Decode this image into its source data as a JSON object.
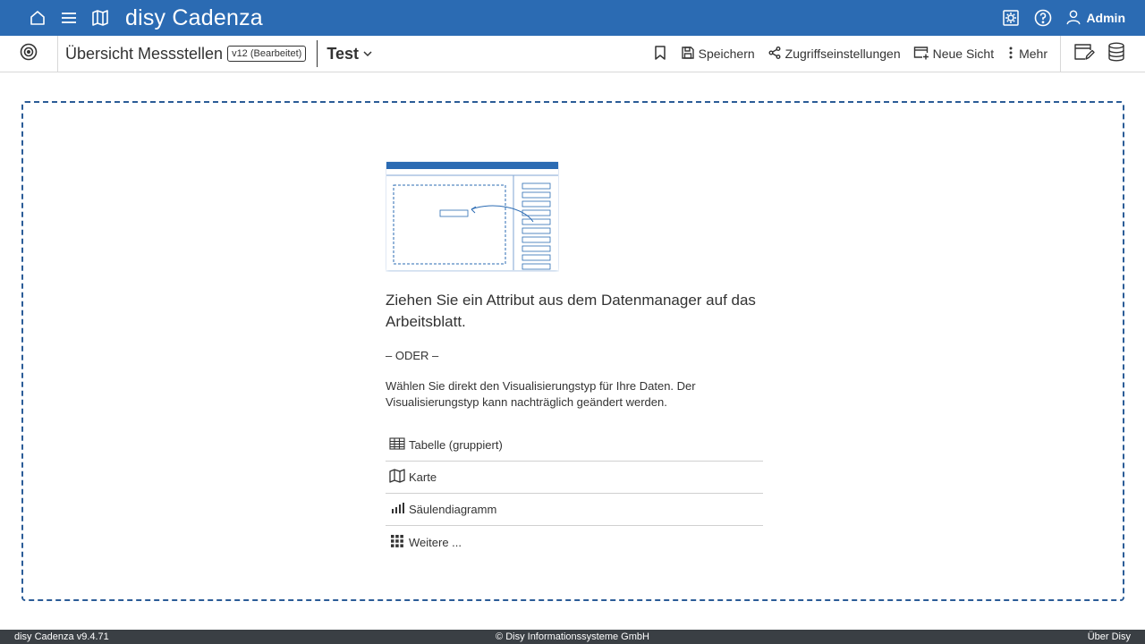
{
  "topbar": {
    "brand": "disy Cadenza",
    "user": "Admin",
    "icons": [
      "home-icon",
      "menu-icon",
      "map-icon",
      "settings-icon",
      "help-icon",
      "user-icon"
    ]
  },
  "toolbar": {
    "workbook_title": "Übersicht Messstellen",
    "version": "v12 (Bearbeitet)",
    "view_name": "Test",
    "save": "Speichern",
    "access": "Zugriffseinstellungen",
    "new_view": "Neue Sicht",
    "more": "Mehr"
  },
  "main": {
    "heading": "Ziehen Sie ein Attribut aus dem Datenmanager auf das Arbeitsblatt.",
    "or": "– ODER –",
    "description": "Wählen Sie direkt den Visualisierungstyp für Ihre Daten. Der Visualisierungstyp kann nachträglich geändert werden.",
    "vis_types": [
      {
        "label": "Tabelle (gruppiert)",
        "icon": "table-icon"
      },
      {
        "label": "Karte",
        "icon": "map-icon"
      },
      {
        "label": "Säulendiagramm",
        "icon": "bar-chart-icon"
      },
      {
        "label": "Weitere ...",
        "icon": "grid-icon"
      }
    ]
  },
  "footer": {
    "version": "disy Cadenza v9.4.71",
    "copyright": "© Disy Informationssysteme GmbH",
    "about": "Über Disy"
  },
  "colors": {
    "brand_blue": "#2b6bb3",
    "footer_bg": "#3a3f44",
    "dashed_border": "#2b5c97"
  }
}
